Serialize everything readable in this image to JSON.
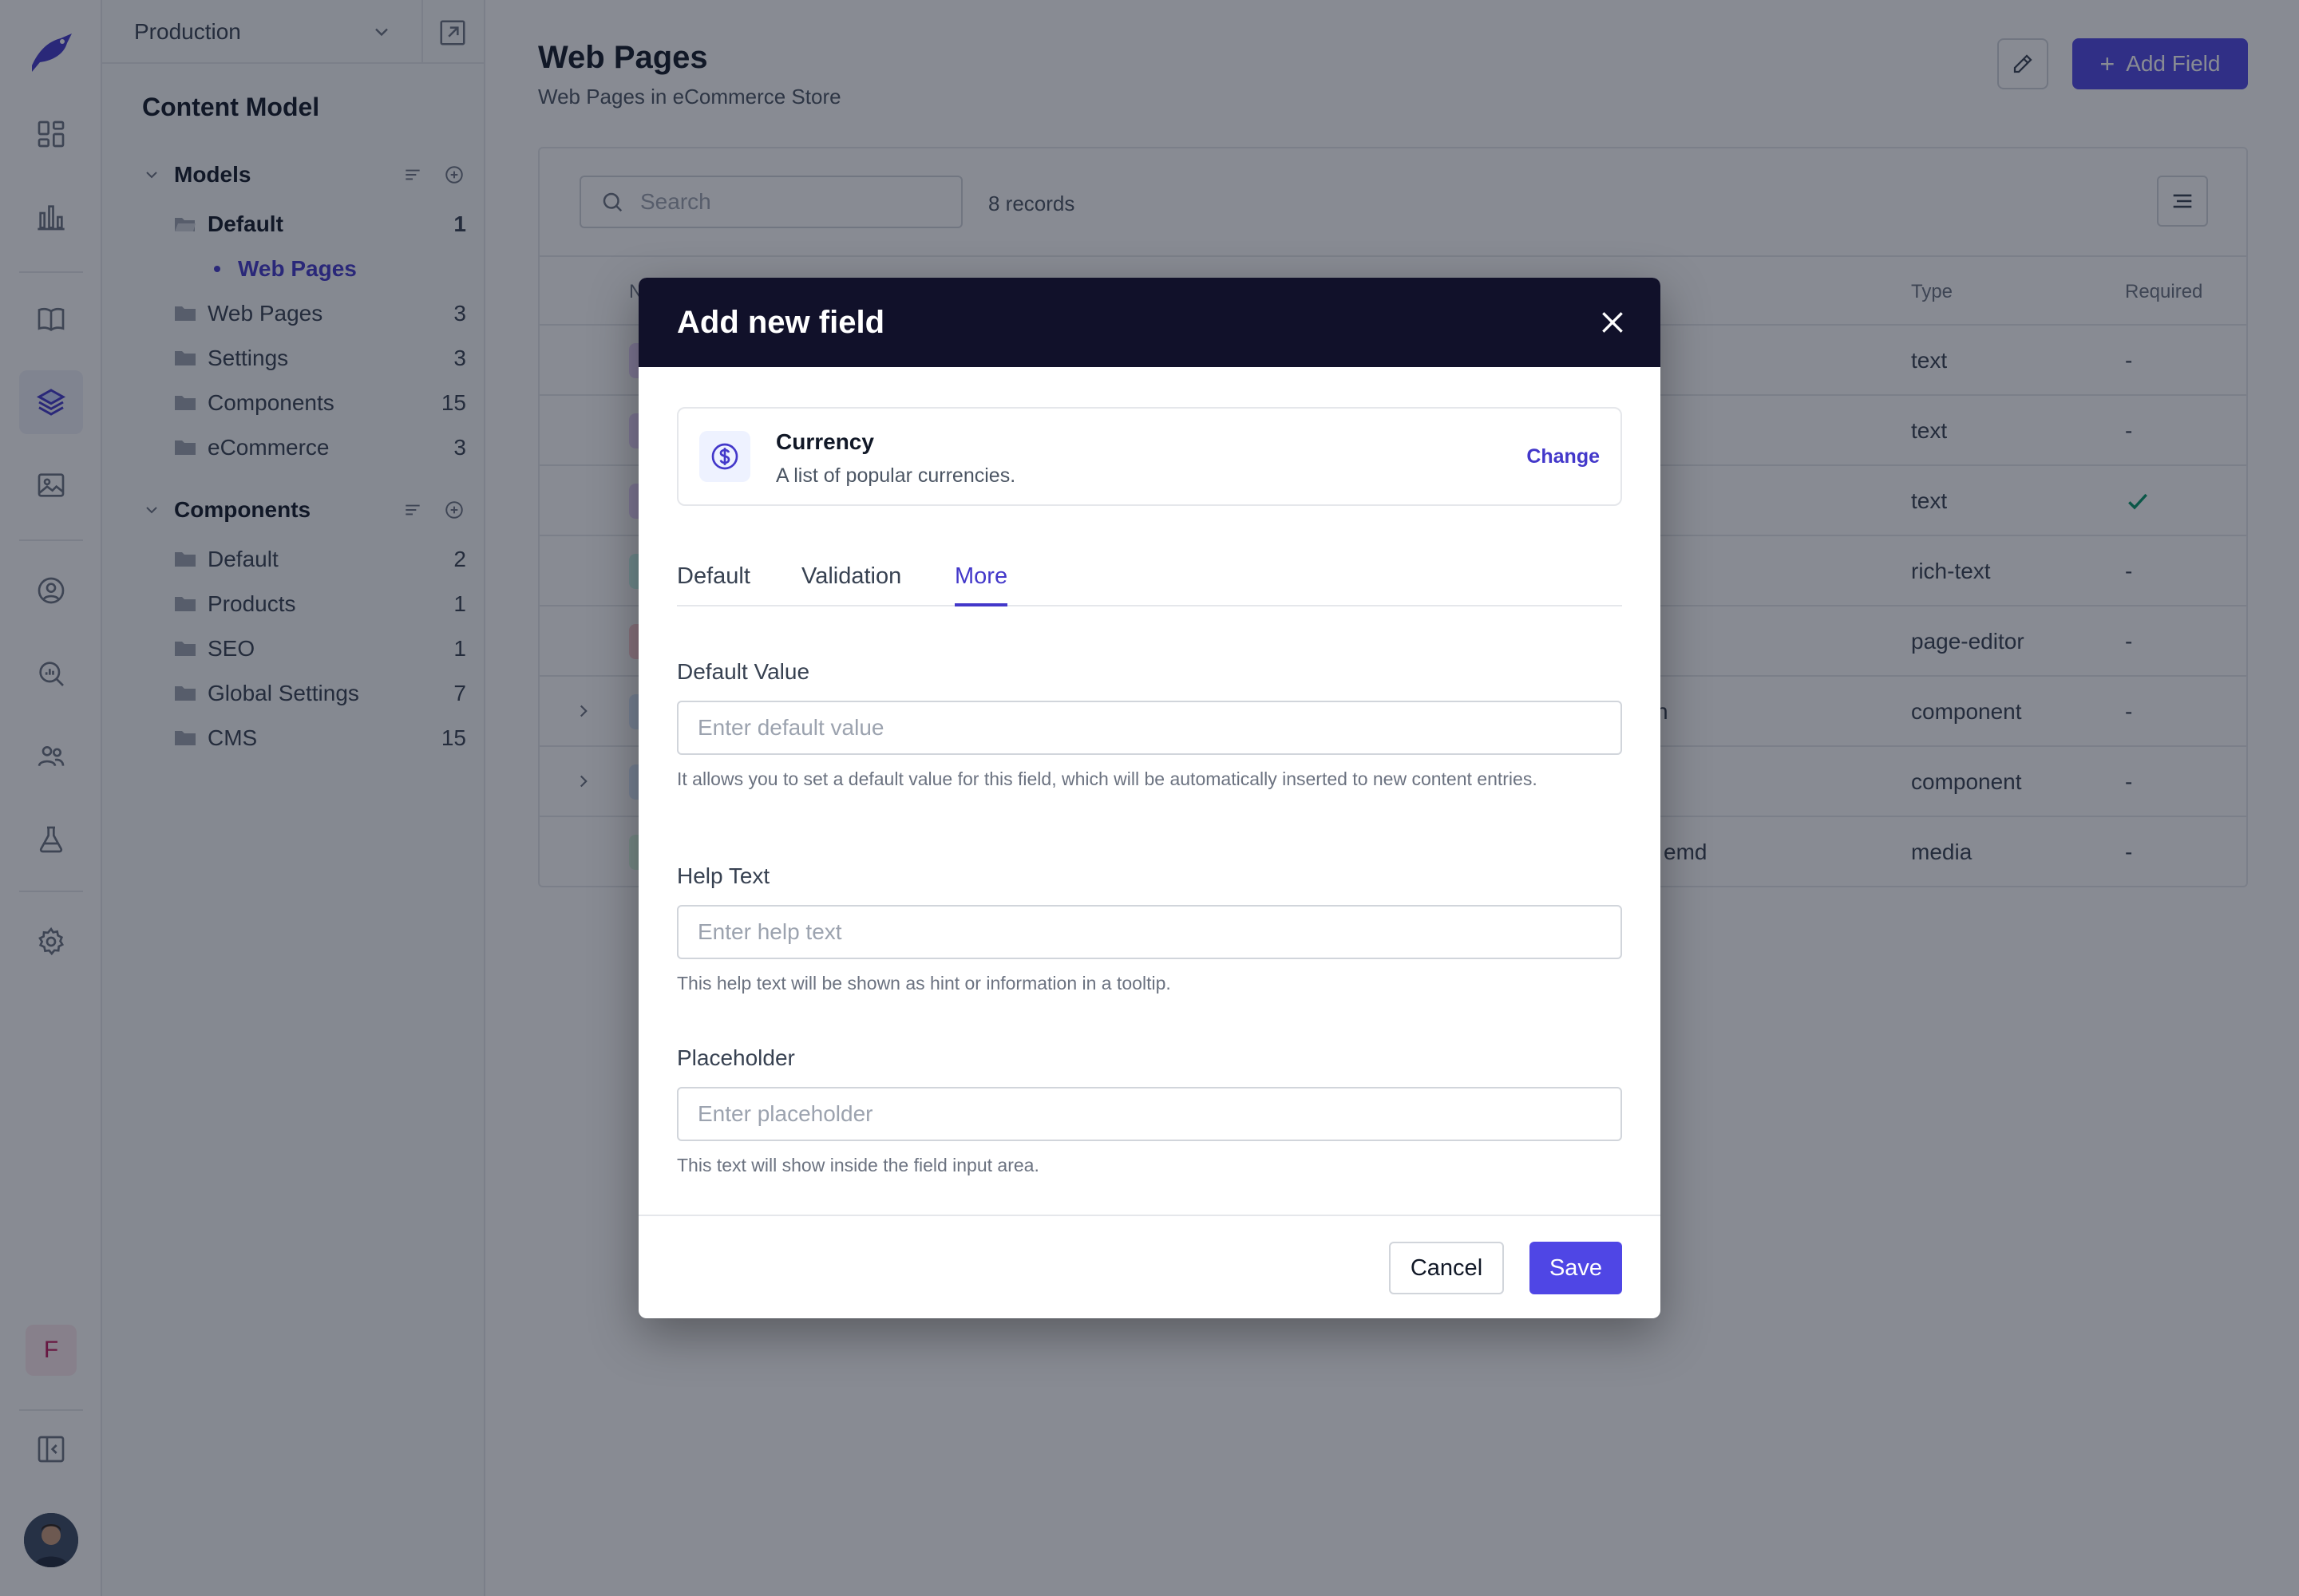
{
  "app": {
    "environment": "Production"
  },
  "rail": {
    "items": [
      "dashboard-icon",
      "analytics-icon",
      "docs-icon",
      "content-model-icon",
      "media-icon",
      "user-circle-icon",
      "search-analytics-icon",
      "team-icon",
      "flask-icon",
      "settings-icon"
    ],
    "active": "content-model-icon",
    "user_initial": "F"
  },
  "sidebar": {
    "title": "Content Model",
    "models": {
      "label": "Models",
      "items": [
        {
          "label": "Default",
          "count": "1",
          "open": true
        },
        {
          "label": "Web Pages",
          "count": "3"
        },
        {
          "label": "Settings",
          "count": "3"
        },
        {
          "label": "Components",
          "count": "15"
        },
        {
          "label": "eCommerce",
          "count": "3"
        }
      ],
      "selected_model": "Web Pages"
    },
    "components": {
      "label": "Components",
      "items": [
        {
          "label": "Default",
          "count": "2"
        },
        {
          "label": "Products",
          "count": "1"
        },
        {
          "label": "SEO",
          "count": "1"
        },
        {
          "label": "Global Settings",
          "count": "7"
        },
        {
          "label": "CMS",
          "count": "15"
        }
      ]
    }
  },
  "main": {
    "title": "Web Pages",
    "subtitle": "Web Pages in eCommerce Store",
    "add_field_label": "Add Field",
    "search_placeholder": "Search",
    "records": "8 records",
    "columns": {
      "name": "N",
      "type": "Type",
      "required": "Required"
    },
    "rows": [
      {
        "name_tail": "",
        "type": "text",
        "required": "-"
      },
      {
        "name_tail": "",
        "type": "text",
        "required": "-"
      },
      {
        "name_tail": "",
        "type": "text",
        "required": "check"
      },
      {
        "name_tail": "",
        "type": "rich-text",
        "required": "-"
      },
      {
        "name_tail": "",
        "type": "page-editor",
        "required": "-"
      },
      {
        "name_tail": "n",
        "type": "component",
        "required": "-"
      },
      {
        "name_tail": "",
        "type": "component",
        "required": "-"
      },
      {
        "name_tail": "emd",
        "type": "media",
        "required": "-"
      }
    ]
  },
  "modal": {
    "title": "Add new field",
    "field_type": {
      "name": "Currency",
      "description": "A list of popular currencies.",
      "change_label": "Change",
      "icon": "currency-dollar-icon"
    },
    "tabs": [
      {
        "label": "Default"
      },
      {
        "label": "Validation"
      },
      {
        "label": "More"
      }
    ],
    "active_tab": "More",
    "fields": {
      "default_value": {
        "label": "Default Value",
        "placeholder": "Enter default value",
        "hint": "It allows you to set a default value for this field, which will be automatically inserted to new content entries."
      },
      "help_text": {
        "label": "Help Text",
        "placeholder": "Enter help text",
        "hint": "This help text will be shown as hint or information in a tooltip."
      },
      "placeholder": {
        "label": "Placeholder",
        "placeholder": "Enter placeholder",
        "hint": "This text will show inside the field input area."
      }
    },
    "cancel_label": "Cancel",
    "save_label": "Save"
  },
  "colors": {
    "accent": "#4f46e5",
    "modal_header": "#11112a",
    "required_check": "#059669",
    "user_badge": "#be185d"
  }
}
